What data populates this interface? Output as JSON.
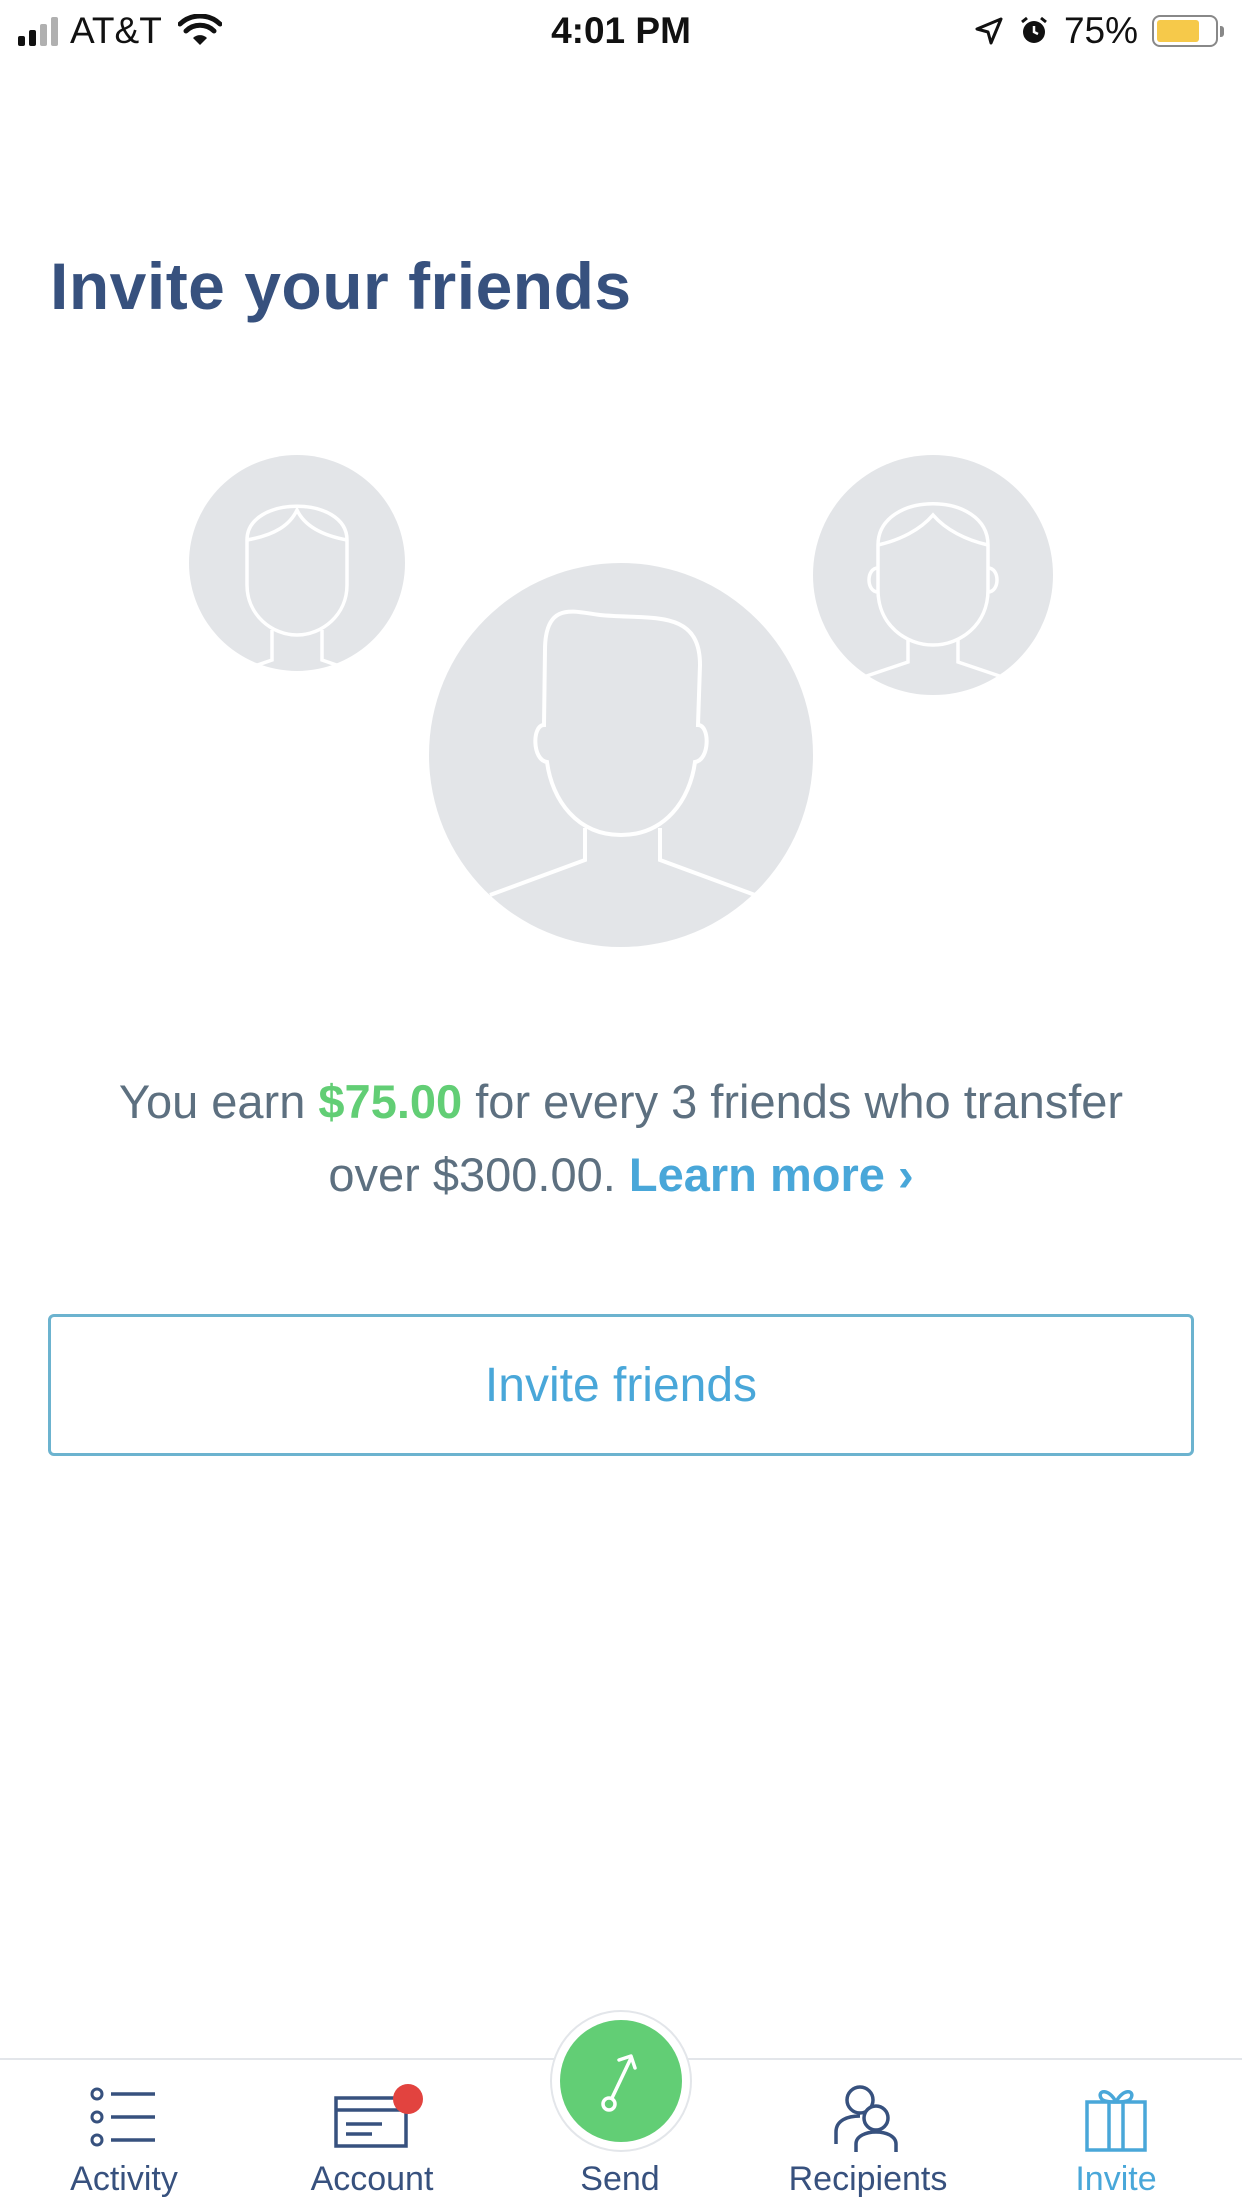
{
  "status_bar": {
    "carrier": "AT&T",
    "time": "4:01 PM",
    "battery_percent": "75%",
    "battery_level": 0.75,
    "icons": [
      "signal-icon",
      "wifi-icon",
      "location-arrow-icon",
      "alarm-icon",
      "battery-icon"
    ]
  },
  "page": {
    "title": "Invite your friends"
  },
  "promo": {
    "prefix": "You earn",
    "amount": "$75.00",
    "middle": "for every 3 friends who transfer over $300.00.",
    "link_label": "Learn more",
    "link_chevron": "›"
  },
  "invite_button": {
    "label": "Invite friends"
  },
  "tab_bar": {
    "tabs": [
      {
        "label": "Activity",
        "icon": "list-icon"
      },
      {
        "label": "Account",
        "icon": "card-icon"
      },
      {
        "label": "Send",
        "icon": "send-arrow-icon"
      },
      {
        "label": "Recipients",
        "icon": "people-icon"
      },
      {
        "label": "Invite",
        "icon": "gift-icon"
      }
    ],
    "active_tab": "Invite"
  },
  "colors": {
    "title": "#37517e",
    "body_text": "#5d7080",
    "amount": "#62ce75",
    "link": "#49a7d9",
    "send_button": "#62ce75",
    "badge": "#e2433f",
    "avatar_bg": "#e3e5e8"
  }
}
